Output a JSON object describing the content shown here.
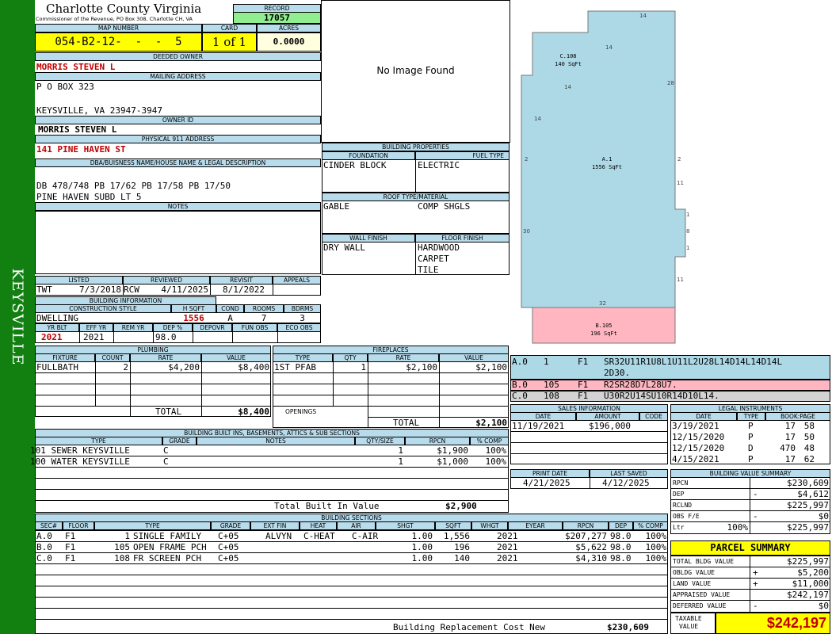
{
  "sidebar": {
    "label": "KEYSVILLE"
  },
  "header": {
    "county": "Charlotte County Virginia",
    "commissioner": "Commissioner of the Revenue, PO Box 308, Charlotte CH, VA",
    "record_label": "RECORD",
    "record_value": "17057",
    "map_number_label": "MAP NUMBER",
    "map_number": "054-B2-12-  -  -  5",
    "card_label": "CARD",
    "card": "1 of 1",
    "acres_label": "ACRES",
    "acres": "0.0000"
  },
  "owner": {
    "deeded_owner_label": "DEEDED OWNER",
    "deeded_owner": "MORRIS STEVEN L",
    "mailing_address_label": "MAILING ADDRESS",
    "mailing_line1": "P O BOX 323",
    "mailing_line2": "KEYSVILLE, VA 23947-3947",
    "owner_id_label": "OWNER ID",
    "owner_id": "MORRIS STEVEN L",
    "physical_address_label": "PHYSICAL 911 ADDRESS",
    "physical_address": "141 PINE HAVEN ST",
    "dba_label": "DBA/BUISNESS NAME/HOUSE NAME & LEGAL DESCRIPTION",
    "legal_line1": "DB 478/748 PB 17/62 PB 17/58 PB 17/50",
    "legal_line2": "PINE HAVEN SUBD LT 5",
    "notes_label": "NOTES"
  },
  "image": {
    "placeholder": "No Image Found"
  },
  "building_properties": {
    "title": "BUILDING PROPERTIES",
    "foundation_label": "FOUNDATION",
    "foundation": "CINDER BLOCK",
    "fuel_label": "FUEL TYPE",
    "fuel": "ELECTRIC",
    "roof_label": "ROOF TYPE/MATERIAL",
    "roof_type": "GABLE",
    "roof_material": "COMP SHGLS",
    "wall_label": "WALL FINISH",
    "wall": "DRY WALL",
    "floor_label": "FLOOR FINISH",
    "floor1": "HARDWOOD",
    "floor2": "CARPET",
    "floor3": "TILE"
  },
  "listing": {
    "listed_label": "LISTED",
    "listed_by": "TWT",
    "listed_date": "7/3/2018",
    "reviewed_label": "REVIEWED",
    "reviewed_by": "RCW",
    "reviewed_date": "4/11/2025",
    "revisit_label": "REVISIT",
    "revisit_date": "8/1/2022",
    "appeals_label": "APPEALS"
  },
  "building_info": {
    "title": "BUILDING INFORMATION",
    "style_label": "CONSTRUCTION STYLE",
    "style": "DWELLING",
    "hsqft_label": "H SQFT",
    "hsqft": "1556",
    "cond_label": "COND",
    "cond": "A",
    "rooms_label": "ROOMS",
    "rooms": "7",
    "bdrms_label": "BDRMS",
    "bdrms": "3",
    "yrblt_label": "YR BLT",
    "yrblt": "2021",
    "effyr_label": "EFF YR",
    "effyr": "2021",
    "remyr_label": "REM YR",
    "dep_label": "DEP %",
    "dep": "98.0",
    "depovr_label": "DEPOVR",
    "funobs_label": "FUN OBS",
    "ecoobs_label": "ECO OBS"
  },
  "plumbing": {
    "title": "PLUMBING",
    "headers": [
      "FIXTURE",
      "COUNT",
      "RATE",
      "VALUE"
    ],
    "rows": [
      {
        "fixture": "FULLBATH",
        "count": "2",
        "rate": "$4,200",
        "value": "$8,400"
      }
    ],
    "total_label": "TOTAL",
    "total": "$8,400"
  },
  "fireplaces": {
    "title": "FIREPLACES",
    "headers": [
      "TYPE",
      "QTY",
      "RATE",
      "VALUE"
    ],
    "rows": [
      {
        "type": "1ST PFAB",
        "qty": "1",
        "rate": "$2,100",
        "value": "$2,100"
      }
    ],
    "openings_label": "OPENINGS",
    "total_label": "TOTAL",
    "total": "$2,100"
  },
  "builtins": {
    "title": "BUILDING BUILT INS, BASEMENTS, ATTICS & SUB SECTIONS",
    "headers": [
      "TYPE",
      "GRADE",
      "NOTES",
      "QTY/SIZE",
      "RPCN",
      "% COMP"
    ],
    "rows": [
      {
        "type": "101 SEWER KEYSVILLE",
        "grade": "C",
        "qty": "1",
        "rpcn": "$1,900",
        "comp": "100%"
      },
      {
        "type": "100 WATER KEYSVILLE",
        "grade": "C",
        "qty": "1",
        "rpcn": "$1,000",
        "comp": "100%"
      }
    ],
    "total_label": "Total Built In Value",
    "total": "$2,900"
  },
  "sections": {
    "title": "BUILDING SECTIONS",
    "headers": [
      "SEC#",
      "FLOOR",
      "TYPE",
      "GRADE",
      "EXT FIN",
      "HEAT",
      "AIR",
      "SHGT",
      "SQFT",
      "WHGT",
      "EYEAR",
      "RPCN",
      "DEP",
      "% COMP"
    ],
    "rows": [
      {
        "sec": "A.0",
        "floor": "F1",
        "code": "1",
        "type": "SINGLE FAMILY",
        "grade": "C+05",
        "ext": "ALVYN",
        "heat": "C-HEAT",
        "air": "C-AIR",
        "shgt": "1.00",
        "sqft": "1,556",
        "eyear": "2021",
        "rpcn": "$207,277",
        "dep": "98.0",
        "comp": "100%"
      },
      {
        "sec": "B.0",
        "floor": "F1",
        "code": "105",
        "type": "OPEN FRAME PCH",
        "grade": "C+05",
        "ext": "",
        "heat": "",
        "air": "",
        "shgt": "1.00",
        "sqft": "196",
        "eyear": "2021",
        "rpcn": "$5,622",
        "dep": "98.0",
        "comp": "100%"
      },
      {
        "sec": "C.0",
        "floor": "F1",
        "code": "108",
        "type": "FR SCREEN PCH",
        "grade": "C+05",
        "ext": "",
        "heat": "",
        "air": "",
        "shgt": "1.00",
        "sqft": "140",
        "eyear": "2021",
        "rpcn": "$4,310",
        "dep": "98.0",
        "comp": "100%"
      }
    ],
    "replacement_label": "Building Replacement Cost New",
    "replacement": "$230,609"
  },
  "sketch": {
    "labels": {
      "c_name": "C.108",
      "c_area": "140 SqFt",
      "a_name": "A.1",
      "a_area": "1556 SqFt",
      "b_name": "B.105",
      "b_area": "196 SqFt"
    },
    "dims": {
      "top": "14",
      "c_right": "14",
      "c_bottom": "14",
      "right_upper": "28",
      "left_upper": "14",
      "left_mid": "2",
      "right_mid": "2",
      "right_11a": "11",
      "right_1a": "1",
      "right_8": "8",
      "right_1b": "1",
      "left_30": "30",
      "right_11b": "11",
      "bottom": "32"
    },
    "colors": {
      "main": "#add8e6",
      "porch": "#ffb6c1",
      "screen": "#d3d3d3"
    },
    "codes": [
      {
        "sec": "A.0",
        "code": "1",
        "floor": "F1",
        "path": "SR32U11R1U8L1U11L2U28L14D14L14D14L",
        "path2": "2D30.",
        "bg": "#add8e6"
      },
      {
        "sec": "B.0",
        "code": "105",
        "floor": "F1",
        "path": "R2SR28D7L28U7.",
        "path2": "",
        "bg": "#ffb6c1"
      },
      {
        "sec": "C.0",
        "code": "108",
        "floor": "F1",
        "path": "U30R2U14SU10R14D10L14.",
        "path2": "",
        "bg": "#d3d3d3"
      }
    ]
  },
  "sales": {
    "title": "SALES INFORMATION",
    "headers": [
      "DATE",
      "AMOUNT",
      "CODE"
    ],
    "rows": [
      {
        "date": "11/19/2021",
        "amount": "$196,000",
        "code": ""
      }
    ]
  },
  "legal_instruments": {
    "title": "LEGAL INSTRUMENTS",
    "headers": [
      "DATE",
      "TYPE",
      "BOOK:PAGE"
    ],
    "rows": [
      {
        "date": "3/19/2021",
        "type": "P",
        "book": "17",
        "page": "58"
      },
      {
        "date": "12/15/2020",
        "type": "P",
        "book": "17",
        "page": "50"
      },
      {
        "date": "12/15/2020",
        "type": "D",
        "book": "470",
        "page": "48"
      },
      {
        "date": "4/15/2021",
        "type": "P",
        "book": "17",
        "page": "62"
      }
    ]
  },
  "dates": {
    "print_label": "PRINT DATE",
    "print_date": "4/21/2025",
    "saved_label": "LAST SAVED",
    "saved_date": "4/12/2025"
  },
  "value_summary": {
    "title": "BUILDING VALUE SUMMARY",
    "rpcn_label": "RPCN",
    "rpcn": "$230,609",
    "dep_label": "DEP",
    "dep_sign": "-",
    "dep": "$4,612",
    "rclnd_label": "RCLND",
    "rclnd": "$225,997",
    "obs_label": "OBS F/E",
    "obs_sign": "-",
    "obs": "$0",
    "ltr_label": "Ltr",
    "ltr_pct": "100%",
    "ltr": "$225,997"
  },
  "parcel_summary": {
    "title": "PARCEL SUMMARY",
    "total_bldg_label": "TOTAL BLDG VALUE",
    "total_bldg": "$225,997",
    "obldg_label": "OBLDG VALUE",
    "obldg_sign": "+",
    "obldg": "$5,200",
    "land_label": "LAND VALUE",
    "land_sign": "+",
    "land": "$11,000",
    "appraised_label": "APPRAISED VALUE",
    "appraised": "$242,197",
    "deferred_label": "DEFERRED VALUE",
    "deferred_sign": "-",
    "deferred": "$0",
    "taxable_label1": "TAXABLE",
    "taxable_label2": "VALUE",
    "taxable": "$242,197"
  }
}
